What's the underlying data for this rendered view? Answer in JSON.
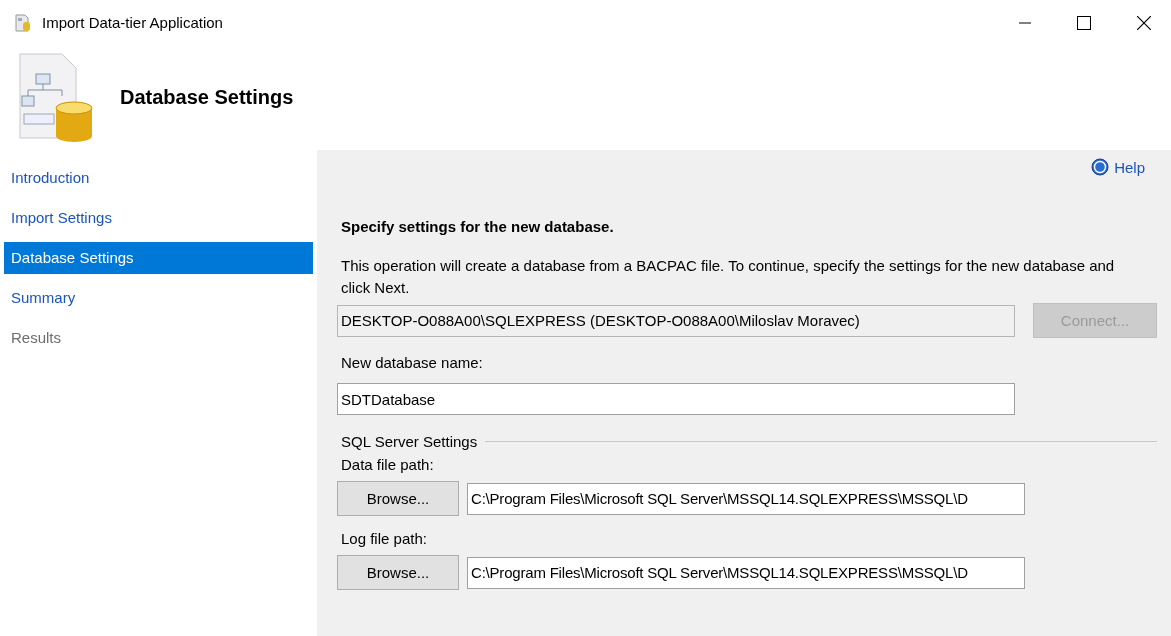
{
  "window": {
    "title": "Import Data-tier Application"
  },
  "header": {
    "title": "Database Settings"
  },
  "sidebar": {
    "items": [
      {
        "label": "Introduction",
        "selected": false,
        "disabled": false
      },
      {
        "label": "Import Settings",
        "selected": false,
        "disabled": false
      },
      {
        "label": "Database Settings",
        "selected": true,
        "disabled": false
      },
      {
        "label": "Summary",
        "selected": false,
        "disabled": false
      },
      {
        "label": "Results",
        "selected": false,
        "disabled": true
      }
    ]
  },
  "help": {
    "label": "Help"
  },
  "heading": "Specify settings for the new database.",
  "description": "This operation will create a database from a BACPAC file. To continue, specify the settings for the new database and click Next.",
  "server": {
    "value": "DESKTOP-O088A00\\SQLEXPRESS (DESKTOP-O088A00\\Miloslav Moravec)",
    "connect_button": {
      "label": "Connect...",
      "disabled": true
    }
  },
  "database_name": {
    "label": "New database name:",
    "value": "SDTDatabase"
  },
  "sql_server_settings": {
    "title": "SQL Server Settings",
    "paths": [
      {
        "label": "Data file path:",
        "button": "Browse...",
        "value": "C:\\Program Files\\Microsoft SQL Server\\MSSQL14.SQLEXPRESS\\MSSQL\\D"
      },
      {
        "label": "Log file path:",
        "button": "Browse...",
        "value": "C:\\Program Files\\Microsoft SQL Server\\MSSQL14.SQLEXPRESS\\MSSQL\\D"
      }
    ]
  }
}
